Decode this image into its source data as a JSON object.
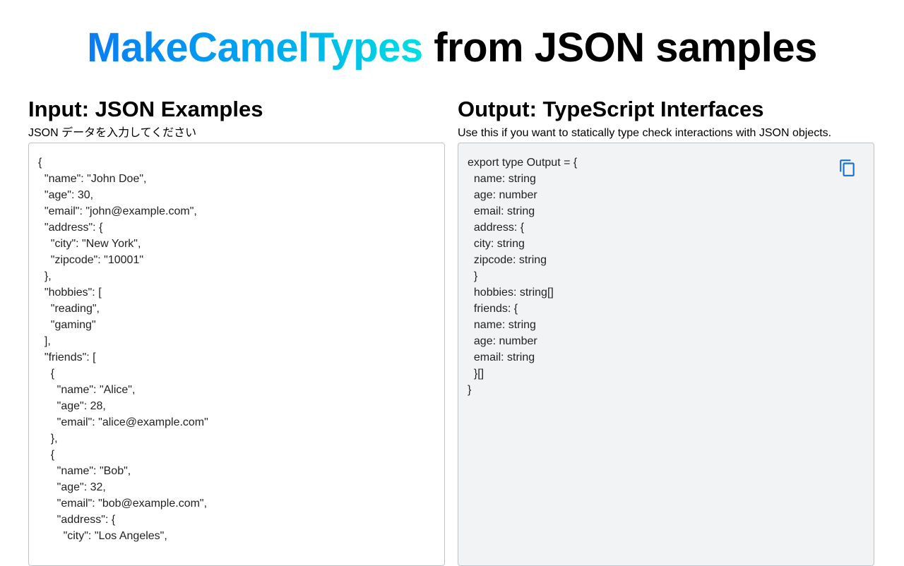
{
  "header": {
    "brand": "MakeCamelTypes",
    "title_rest": " from JSON samples"
  },
  "input_panel": {
    "title": "Input: JSON Examples",
    "placeholder": "JSON データを入力してください",
    "value": "{\n  \"name\": \"John Doe\",\n  \"age\": 30,\n  \"email\": \"john@example.com\",\n  \"address\": {\n    \"city\": \"New York\",\n    \"zipcode\": \"10001\"\n  },\n  \"hobbies\": [\n    \"reading\",\n    \"gaming\"\n  ],\n  \"friends\": [\n    {\n      \"name\": \"Alice\",\n      \"age\": 28,\n      \"email\": \"alice@example.com\"\n    },\n    {\n      \"name\": \"Bob\",\n      \"age\": 32,\n      \"email\": \"bob@example.com\",\n      \"address\": {\n        \"city\": \"Los Angeles\","
  },
  "output_panel": {
    "title": "Output: TypeScript Interfaces",
    "description": "Use this if you want to statically type check interactions with JSON objects.",
    "code": "export type Output = {\n  name: string\n  age: number\n  email: string\n  address: {\n  city: string\n  zipcode: string\n  }\n  hobbies: string[]\n  friends: {\n  name: string\n  age: number\n  email: string\n  }[]\n}",
    "copy_icon": "copy-icon"
  },
  "colors": {
    "brand_gradient_start": "#0a7cf5",
    "brand_gradient_end": "#00dfe0",
    "copy_icon": "#1a73c8",
    "output_bg": "#f2f3f5"
  }
}
